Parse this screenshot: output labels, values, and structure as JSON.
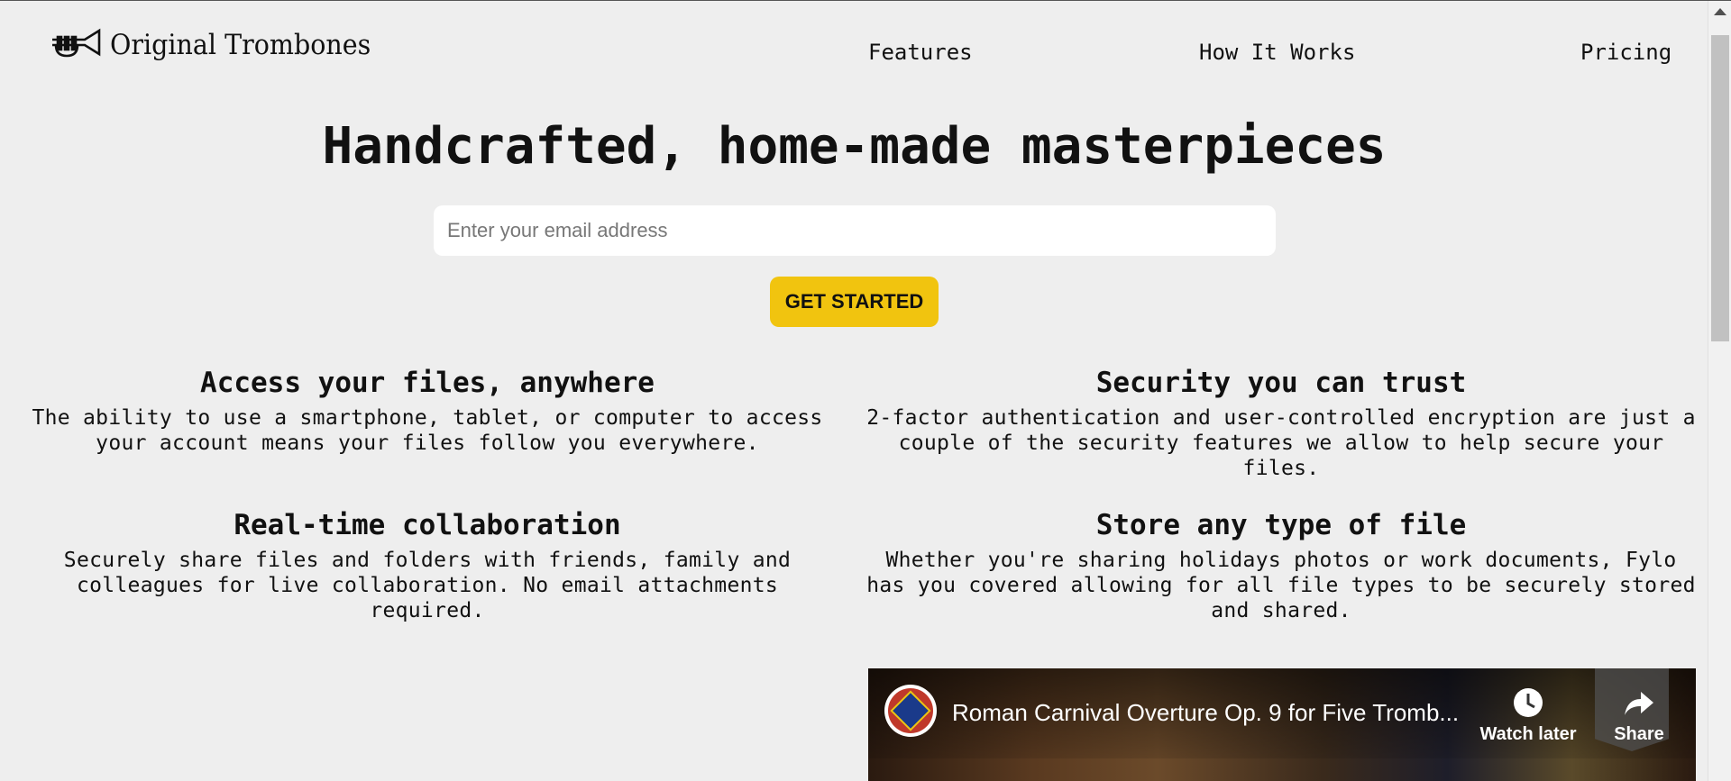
{
  "brand": {
    "name": "Original Trombones",
    "logo_icon": "trumpet-icon"
  },
  "nav": {
    "items": [
      {
        "label": "Features"
      },
      {
        "label": "How It Works"
      },
      {
        "label": "Pricing"
      }
    ]
  },
  "hero": {
    "title": "Handcrafted, home-made masterpieces",
    "email_placeholder": "Enter your email address",
    "cta_label": "GET STARTED"
  },
  "features": [
    {
      "title": "Access your files, anywhere",
      "text": "The ability to use a smartphone, tablet, or computer to access your account means your files follow you everywhere."
    },
    {
      "title": "Security you can trust",
      "text": "2-factor authentication and user-controlled encryption are just a couple of the security features we allow to help secure your files."
    },
    {
      "title": "Real-time collaboration",
      "text": "Securely share files and folders with friends, family and colleagues for live collaboration. No email attachments required."
    },
    {
      "title": "Store any type of file",
      "text": "Whether you're sharing holidays photos or work documents, Fylo has you covered allowing for all file types to be securely stored and shared."
    }
  ],
  "video": {
    "title": "Roman Carnival Overture Op. 9 for Five Tromb...",
    "watch_later_label": "Watch later",
    "share_label": "Share"
  },
  "colors": {
    "background": "#eeeeee",
    "cta": "#f1c40f"
  }
}
